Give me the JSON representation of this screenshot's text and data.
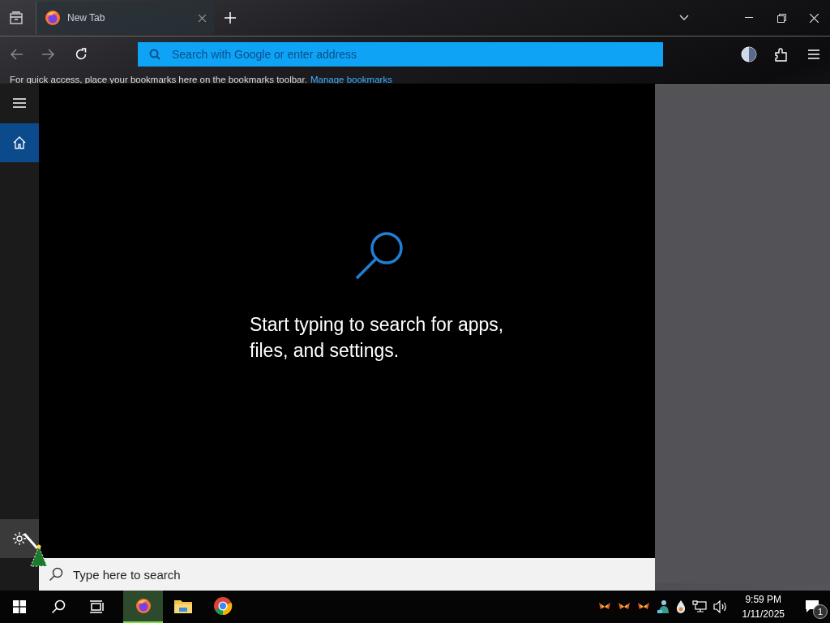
{
  "browser": {
    "tabs": [
      {
        "label": "New Tab",
        "selected": true
      }
    ],
    "address_bar": {
      "placeholder": "Search with Google or enter address"
    },
    "bookmarks_toolbar": {
      "message": "For quick access, place your bookmarks here on the bookmarks toolbar.",
      "link": "Manage bookmarks"
    }
  },
  "start_menu": {
    "rail": [
      {
        "kind": "menu",
        "selected": false,
        "hovered": false
      },
      {
        "kind": "home",
        "selected": true,
        "hovered": false
      },
      {
        "kind": "settings",
        "selected": false,
        "hovered": true
      }
    ],
    "empty_message": "Start typing to search for apps, files, and settings.",
    "search_box": {
      "placeholder": "Type here to search"
    }
  },
  "taskbar": {
    "buttons": [
      {
        "kind": "start"
      },
      {
        "kind": "search"
      },
      {
        "kind": "task-view"
      }
    ],
    "apps": [
      {
        "kind": "firefox",
        "active": true
      },
      {
        "kind": "explorer",
        "active": false
      },
      {
        "kind": "chrome",
        "active": false
      }
    ],
    "tray_icons": [
      {
        "kind": "butterfly"
      },
      {
        "kind": "butterfly"
      },
      {
        "kind": "butterfly"
      },
      {
        "kind": "person"
      },
      {
        "kind": "droplet"
      },
      {
        "kind": "network"
      },
      {
        "kind": "volume"
      }
    ],
    "clock": {
      "time": "9:59 PM",
      "date": "1/11/2025"
    },
    "notifications": {
      "count": "1"
    }
  }
}
